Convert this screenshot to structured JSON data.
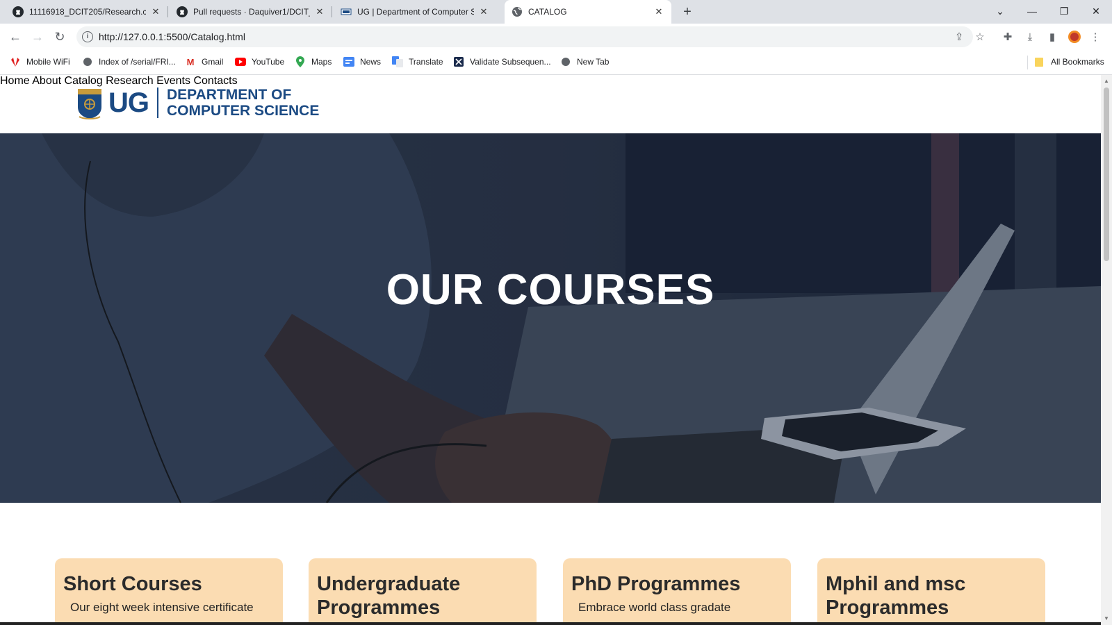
{
  "browser": {
    "tabs": [
      {
        "title": "11116918_DCIT205/Research.css",
        "icon": "github-icon"
      },
      {
        "title": "Pull requests · Daquiver1/DCIT_2",
        "icon": "github-icon"
      },
      {
        "title": "UG | Department of Computer S",
        "icon": "ug-favicon-icon"
      },
      {
        "title": "CATALOG",
        "icon": "globe-icon"
      }
    ],
    "new_tab": "+",
    "url": "http://127.0.0.1:5500/Catalog.html",
    "bookmarks": [
      {
        "label": "Mobile WiFi",
        "icon": "huawei-icon"
      },
      {
        "label": "Index of /serial/FRI...",
        "icon": "globe-icon"
      },
      {
        "label": "Gmail",
        "icon": "gmail-icon"
      },
      {
        "label": "YouTube",
        "icon": "youtube-icon"
      },
      {
        "label": "Maps",
        "icon": "maps-icon"
      },
      {
        "label": "News",
        "icon": "news-icon"
      },
      {
        "label": "Translate",
        "icon": "translate-icon"
      },
      {
        "label": "Validate Subsequen...",
        "icon": "validate-icon"
      },
      {
        "label": "New Tab",
        "icon": "globe-icon"
      }
    ],
    "all_bookmarks": "All Bookmarks"
  },
  "site": {
    "logo_ug": "UG",
    "logo_line1": "DEPARTMENT OF",
    "logo_line2": "COMPUTER SCIENCE",
    "nav": [
      "Home",
      "About",
      "Catalog",
      "Research",
      "Events",
      "Contacts"
    ],
    "hero_title": "OUR COURSES",
    "cards": [
      {
        "title": "Short Courses",
        "text": "Our eight week intensive certificate"
      },
      {
        "title": "Undergraduate Programmes",
        "text": ""
      },
      {
        "title": "PhD Programmes",
        "text": "Embrace world class gradate"
      },
      {
        "title": "Mphil and msc Programmes",
        "text": ""
      }
    ]
  },
  "colors": {
    "brand_blue": "#1b4a83",
    "card_bg": "#fbdcb2"
  }
}
